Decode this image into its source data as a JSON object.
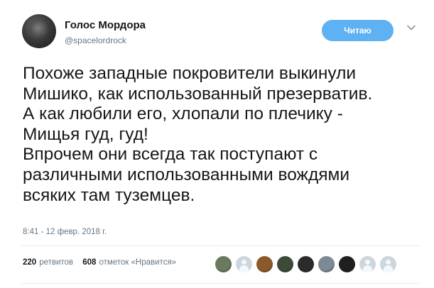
{
  "tweet": {
    "author_name": "Голос Мордора",
    "author_handle": "@spacelordrock",
    "follow_label": "Читаю",
    "text": "Похоже западные покровители выкинули\nМишико, как использованный презерватив.\nА как любили его, хлопали по плечику -\nМищья гуд, гуд!\nВпрочем они всегда так поступают с\nразличными использованными вождями\nвсяких там туземцев.",
    "timestamp": "8:41 - 12 февр. 2018 г.",
    "retweets": {
      "count": "220",
      "label": "ретвитов"
    },
    "likes": {
      "count": "608",
      "label": "отметок «Нравится»"
    }
  },
  "colors": {
    "follow_button": "#5eb1f2",
    "secondary_text": "#657786",
    "divider": "#e6ecf0"
  },
  "likers": [
    {
      "kind": "photo",
      "color": "#6b7a5e"
    },
    {
      "kind": "default",
      "color": "#ccd6dd"
    },
    {
      "kind": "photo",
      "color": "#8a5a2a"
    },
    {
      "kind": "photo",
      "color": "#3e4a38"
    },
    {
      "kind": "photo",
      "color": "#2b2b2b"
    },
    {
      "kind": "photo",
      "color": "#7d8a94"
    },
    {
      "kind": "photo",
      "color": "#1f1f1f"
    },
    {
      "kind": "default",
      "color": "#ccd6dd"
    },
    {
      "kind": "default",
      "color": "#ccd6dd"
    }
  ]
}
